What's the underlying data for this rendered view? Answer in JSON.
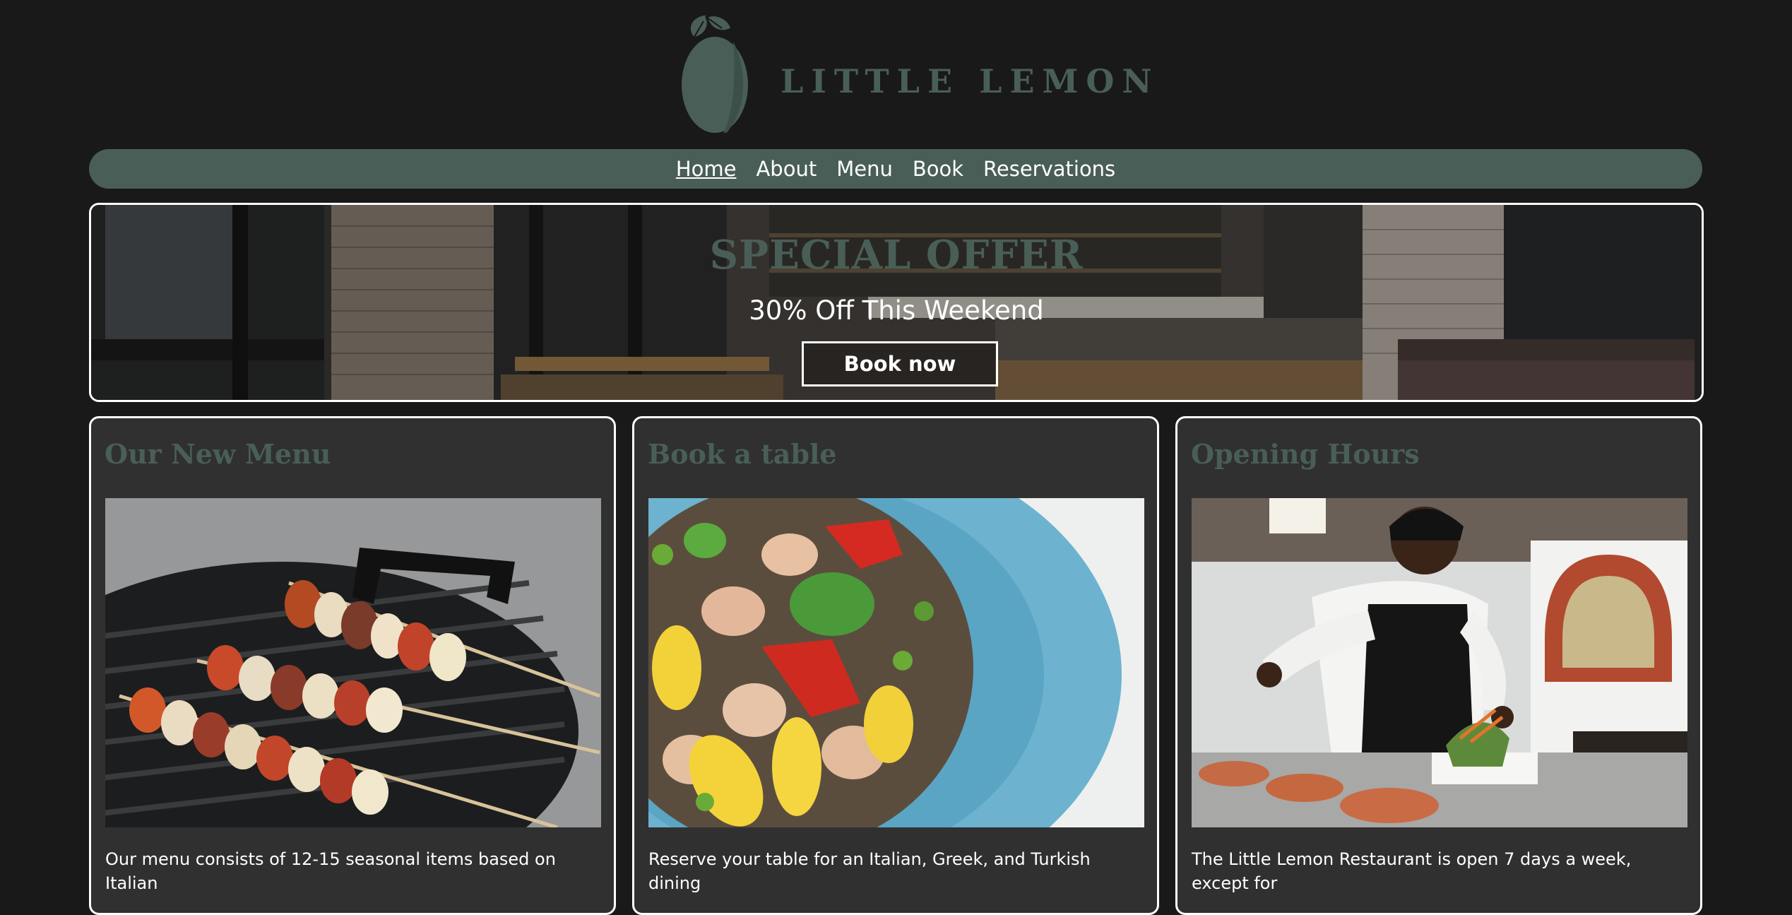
{
  "brand": {
    "name": "LITTLE LEMON",
    "color": "#495e57"
  },
  "nav": {
    "items": [
      {
        "label": "Home",
        "active": true
      },
      {
        "label": "About",
        "active": false
      },
      {
        "label": "Menu",
        "active": false
      },
      {
        "label": "Book",
        "active": false
      },
      {
        "label": "Reservations",
        "active": false
      }
    ]
  },
  "hero": {
    "title": "SPECIAL OFFER",
    "subtitle": "30% Off This Weekend",
    "button": "Book now"
  },
  "cards": [
    {
      "title": "Our New Menu",
      "image": "grilled-skewers",
      "text": "Our menu consists of 12-15 seasonal items based on Italian"
    },
    {
      "title": "Book a table",
      "image": "salmon-salad",
      "text": "Reserve your table for an Italian, Greek, and Turkish dining"
    },
    {
      "title": "Opening Hours",
      "image": "chef-plating",
      "text": "The Little Lemon Restaurant is open 7 days a week, except for"
    }
  ]
}
